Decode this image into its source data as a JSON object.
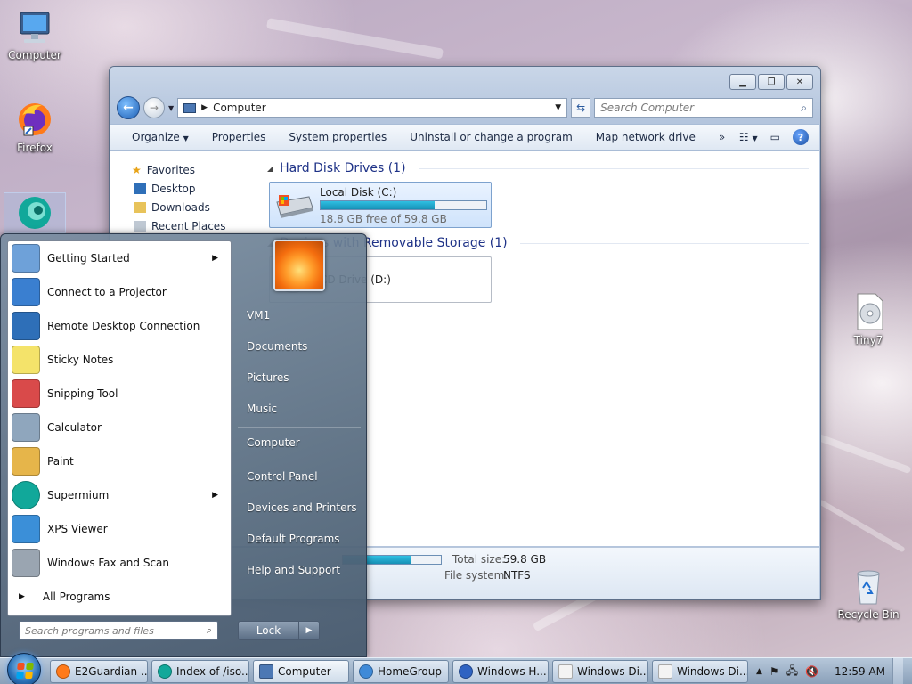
{
  "desktop": {
    "icons": [
      {
        "label": "Computer"
      },
      {
        "label": "Firefox"
      },
      {
        "label": ""
      },
      {
        "label": "Tiny7"
      },
      {
        "label": "Recycle Bin"
      }
    ]
  },
  "explorer": {
    "address": "Computer",
    "search_placeholder": "Search Computer",
    "toolbar": {
      "organize": "Organize",
      "properties": "Properties",
      "system_properties": "System properties",
      "uninstall": "Uninstall or change a program",
      "map_drive": "Map network drive",
      "more": "»"
    },
    "nav": {
      "favorites": "Favorites",
      "desktop": "Desktop",
      "downloads": "Downloads",
      "recent": "Recent Places"
    },
    "groups": {
      "hdd": "Hard Disk Drives (1)",
      "removable": "Devices with Removable Storage (1)"
    },
    "drives": [
      {
        "name": "Local Disk (C:)",
        "free_text": "18.8 GB free of 59.8 GB",
        "used_fraction": 0.69
      },
      {
        "name": "CD Drive (D:)"
      }
    ],
    "details": {
      "total_label": "Total size:",
      "total_value": "59.8 GB",
      "fs_label": "File system:",
      "fs_value": "NTFS",
      "used_fraction": 0.69
    }
  },
  "start_menu": {
    "programs": [
      {
        "label": "Getting Started",
        "submenu": true,
        "icon": "getting-started"
      },
      {
        "label": "Connect to a Projector",
        "submenu": false,
        "icon": "projector"
      },
      {
        "label": "Remote Desktop Connection",
        "submenu": false,
        "icon": "remote-desktop"
      },
      {
        "label": "Sticky Notes",
        "submenu": false,
        "icon": "sticky-notes"
      },
      {
        "label": "Snipping Tool",
        "submenu": false,
        "icon": "snipping-tool"
      },
      {
        "label": "Calculator",
        "submenu": false,
        "icon": "calculator"
      },
      {
        "label": "Paint",
        "submenu": false,
        "icon": "paint"
      },
      {
        "label": "Supermium",
        "submenu": true,
        "icon": "supermium"
      },
      {
        "label": "XPS Viewer",
        "submenu": false,
        "icon": "xps-viewer"
      },
      {
        "label": "Windows Fax and Scan",
        "submenu": false,
        "icon": "fax-scan"
      }
    ],
    "all_programs": "All Programs",
    "search_placeholder": "Search programs and files",
    "right": {
      "user": "VM1",
      "documents": "Documents",
      "pictures": "Pictures",
      "music": "Music",
      "computer": "Computer",
      "control_panel": "Control Panel",
      "devices": "Devices and Printers",
      "default_programs": "Default Programs",
      "help": "Help and Support"
    },
    "lock_label": "Lock"
  },
  "taskbar": {
    "items": [
      {
        "label": "E2Guardian ...",
        "icon": "firefox"
      },
      {
        "label": "Index of /iso...",
        "icon": "supermium"
      },
      {
        "label": "Computer",
        "icon": "computer"
      },
      {
        "label": "HomeGroup",
        "icon": "homegroup"
      },
      {
        "label": "Windows H...",
        "icon": "help"
      },
      {
        "label": "Windows Di...",
        "icon": "document"
      },
      {
        "label": "Windows Di...",
        "icon": "document"
      }
    ],
    "clock": "12:59 AM"
  },
  "colors": {
    "accent": "#1e3287",
    "drive_fill": "#1690b5"
  }
}
